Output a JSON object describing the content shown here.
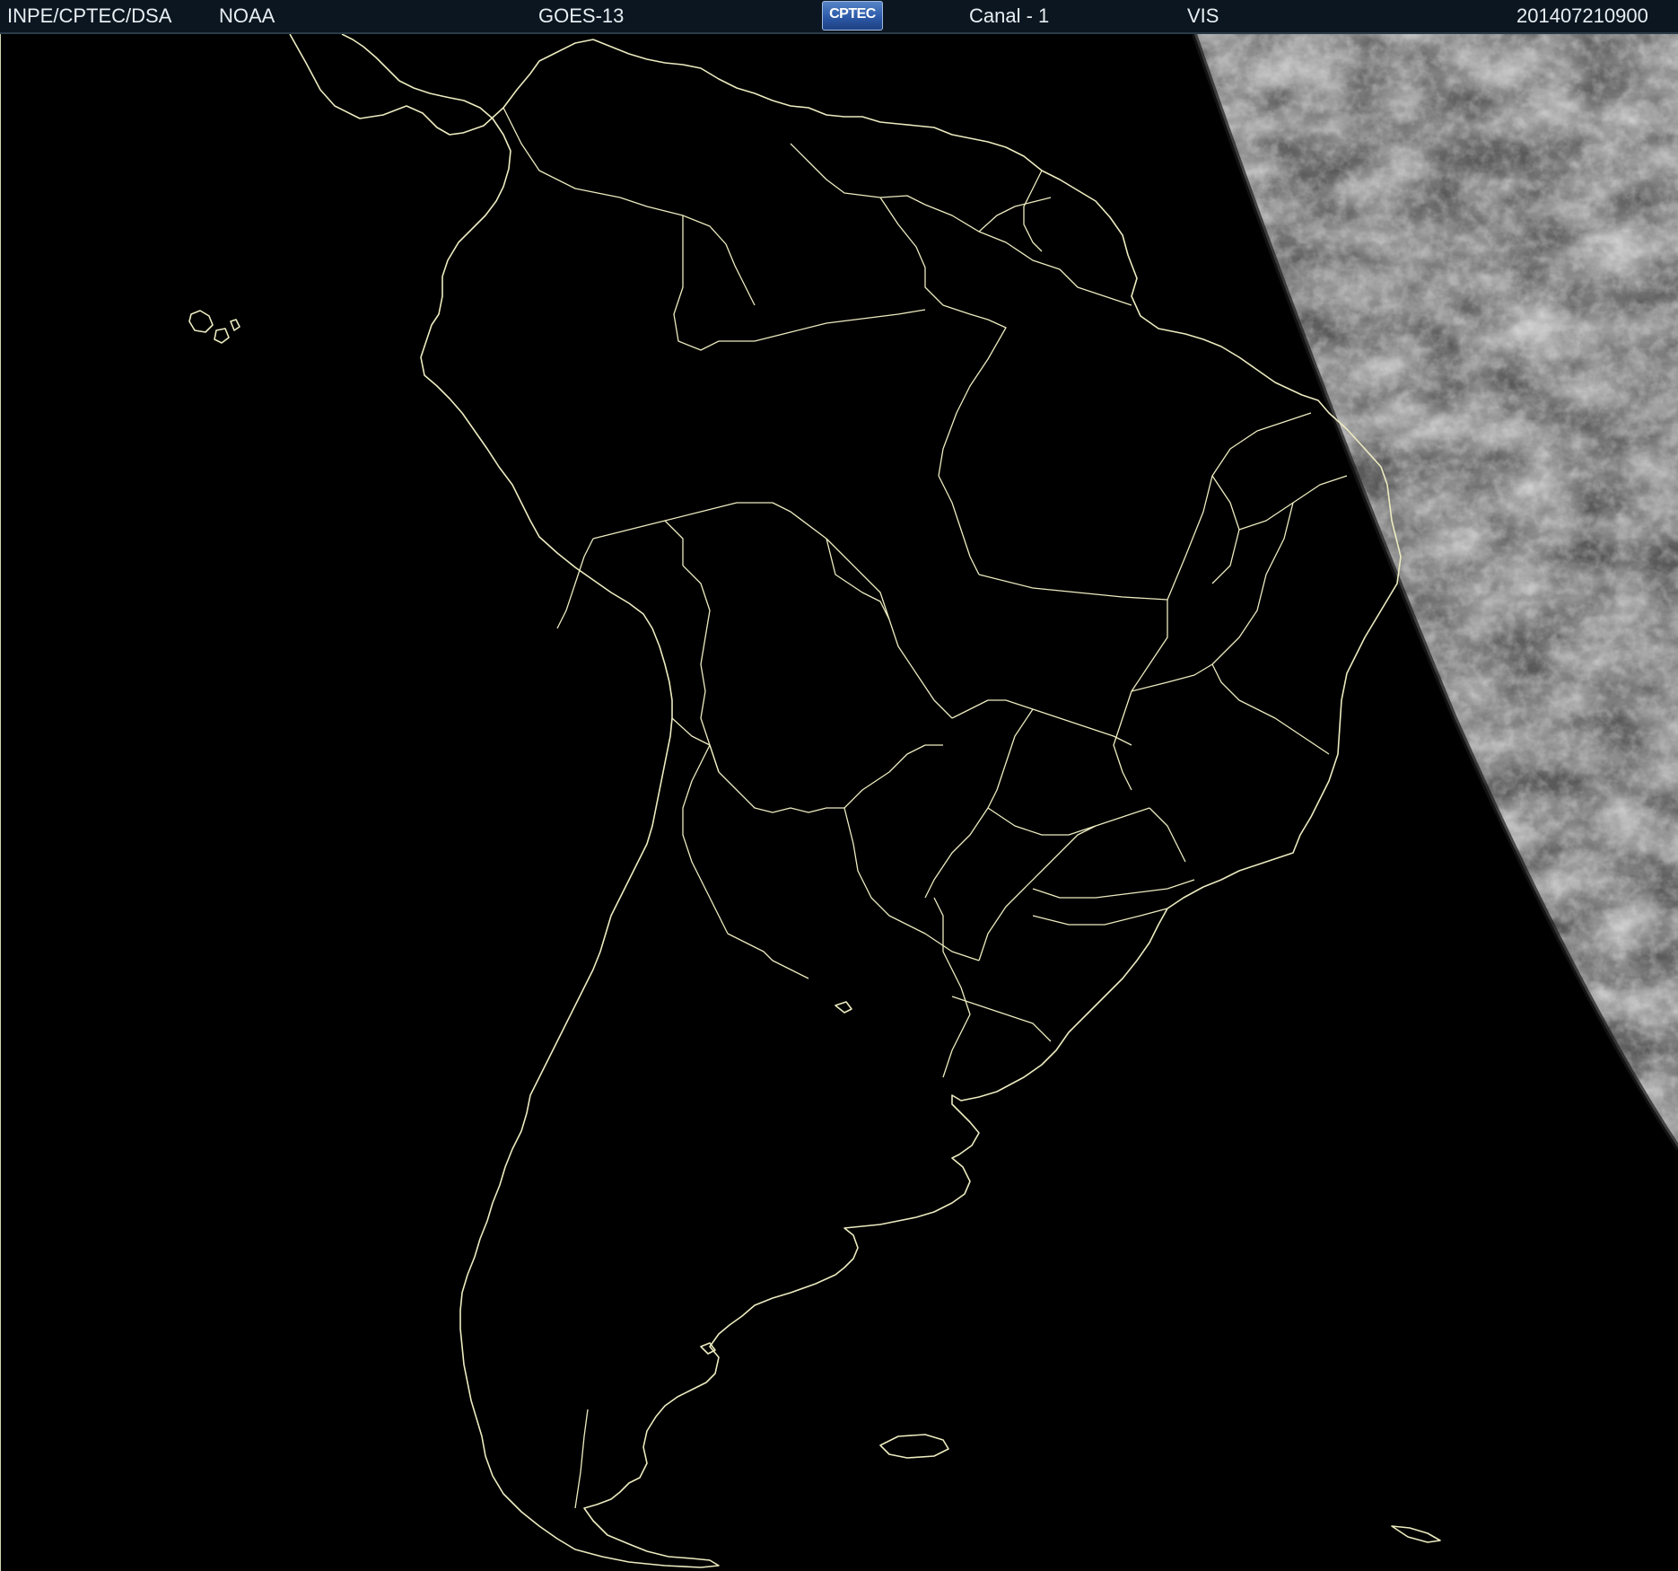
{
  "header": {
    "agency": "INPE/CPTEC/DSA",
    "source": "NOAA",
    "satellite": "GOES-13",
    "logo_text": "CPTEC",
    "channel": "Canal - 1",
    "band": "VIS",
    "timestamp": "201407210900"
  },
  "colors": {
    "background": "#000000",
    "map_lines": "#ecebc0",
    "header_bg": "#0b1620",
    "header_text": "#e8eef2",
    "cloud_tone": "#8f8f8f"
  },
  "map": {
    "region": "South America",
    "layers": [
      "coastlines",
      "country-borders",
      "state-borders",
      "visible-satellite-imagery"
    ],
    "illuminated_side": "east"
  }
}
